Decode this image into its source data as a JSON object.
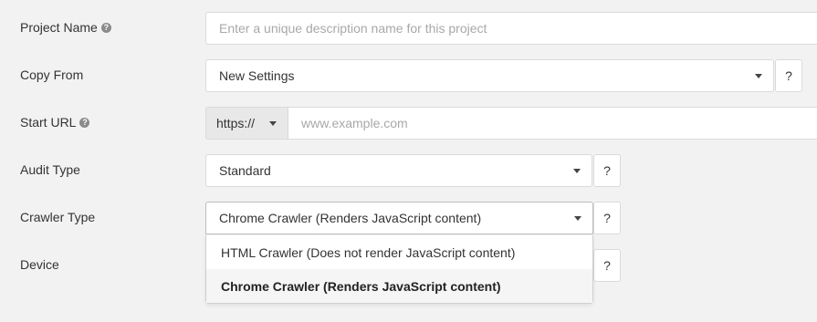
{
  "form": {
    "project_name": {
      "label": "Project Name",
      "placeholder": "Enter a unique description name for this project"
    },
    "copy_from": {
      "label": "Copy From",
      "value": "New Settings",
      "help": "?"
    },
    "start_url": {
      "label": "Start URL",
      "protocol": "https://",
      "placeholder": "www.example.com"
    },
    "audit_type": {
      "label": "Audit Type",
      "value": "Standard",
      "help": "?"
    },
    "crawler_type": {
      "label": "Crawler Type",
      "value": "Chrome Crawler (Renders JavaScript content)",
      "help": "?",
      "options": [
        "HTML Crawler (Does not render JavaScript content)",
        "Chrome Crawler (Renders JavaScript content)"
      ]
    },
    "device": {
      "label": "Device",
      "help": "?"
    }
  },
  "icons": {
    "help_circle": "question-circle-icon",
    "caret": "caret-down-icon"
  }
}
